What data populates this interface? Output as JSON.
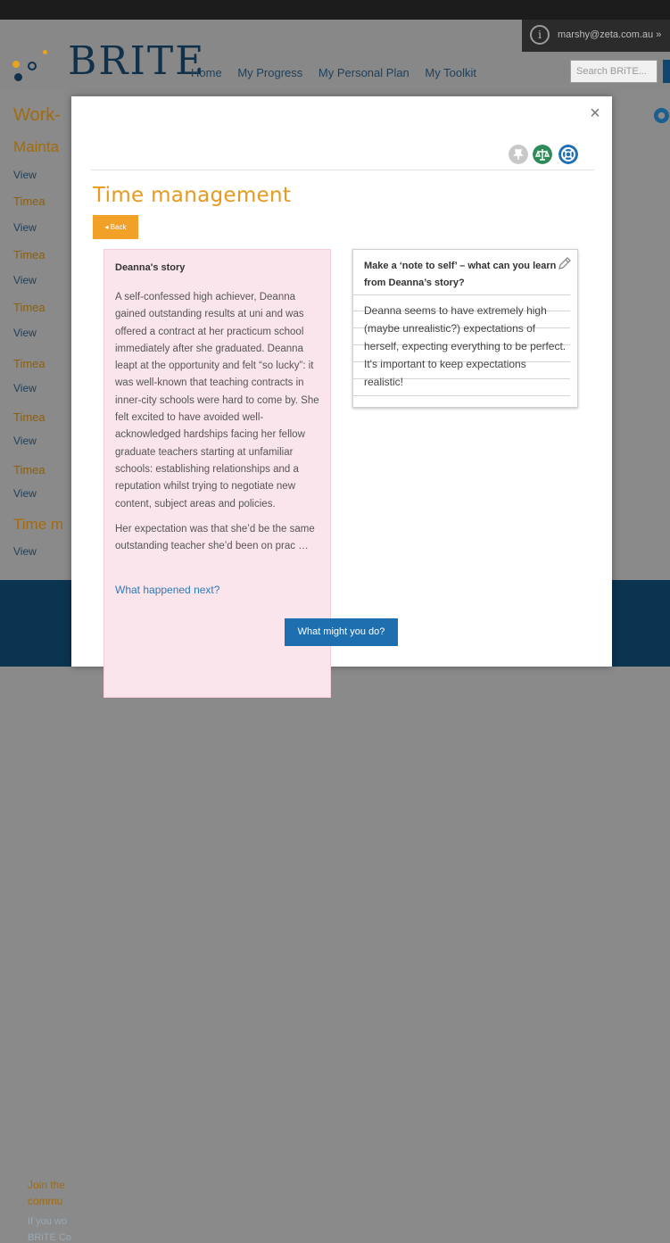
{
  "header": {
    "email": "marshy@zeta.com.au »",
    "logo_text": "BRITE",
    "nav": [
      "Home",
      "My Progress",
      "My Personal Plan",
      "My Toolkit"
    ],
    "search_placeholder": "Search BRiTE..."
  },
  "background": {
    "items": [
      {
        "label": "Work-",
        "view": "View"
      },
      {
        "label": "Mainta",
        "view": "View"
      },
      {
        "label": "Time m",
        "view": "View"
      }
    ],
    "footer": [
      "Join the",
      "commu",
      "If you wo",
      "BRiTE Co"
    ]
  },
  "modal": {
    "close": "×",
    "title": "Time management",
    "back_label": "Back",
    "story": {
      "heading": "Deanna's story",
      "p1": "A self-confessed high achiever, Deanna gained outstanding results at uni and was offered a contract at her practicum school immediately after she graduated. Deanna leapt at the opportunity and felt “so lucky”: it was well-known that teaching contracts in inner-city schools were hard to come by. She felt excited to have avoided well-acknowledged hardships facing her fellow graduate teachers starting at unfamiliar schools: establishing relationships and a reputation whilst trying to negotiate new content, subject areas and policies.",
      "p2": "Her expectation was that she’d be the same outstanding teacher she’d been on prac …",
      "link": "What happened next?"
    },
    "note": {
      "heading": "Make a ‘note to self’ – what can you learn from Deanna’s story?",
      "text": "Deanna seems to have extremely high (maybe unrealistic?) expectations of herself, expecting everything to be perfect. It's important to keep expectations realistic!"
    },
    "action_label": "What might you do?"
  },
  "colors": {
    "accent_orange": "#f2a128",
    "title_orange": "#e79a1f",
    "button_blue": "#1d6fb0",
    "story_pink": "#fbe5ec",
    "footer_navy": "#0b3450"
  }
}
